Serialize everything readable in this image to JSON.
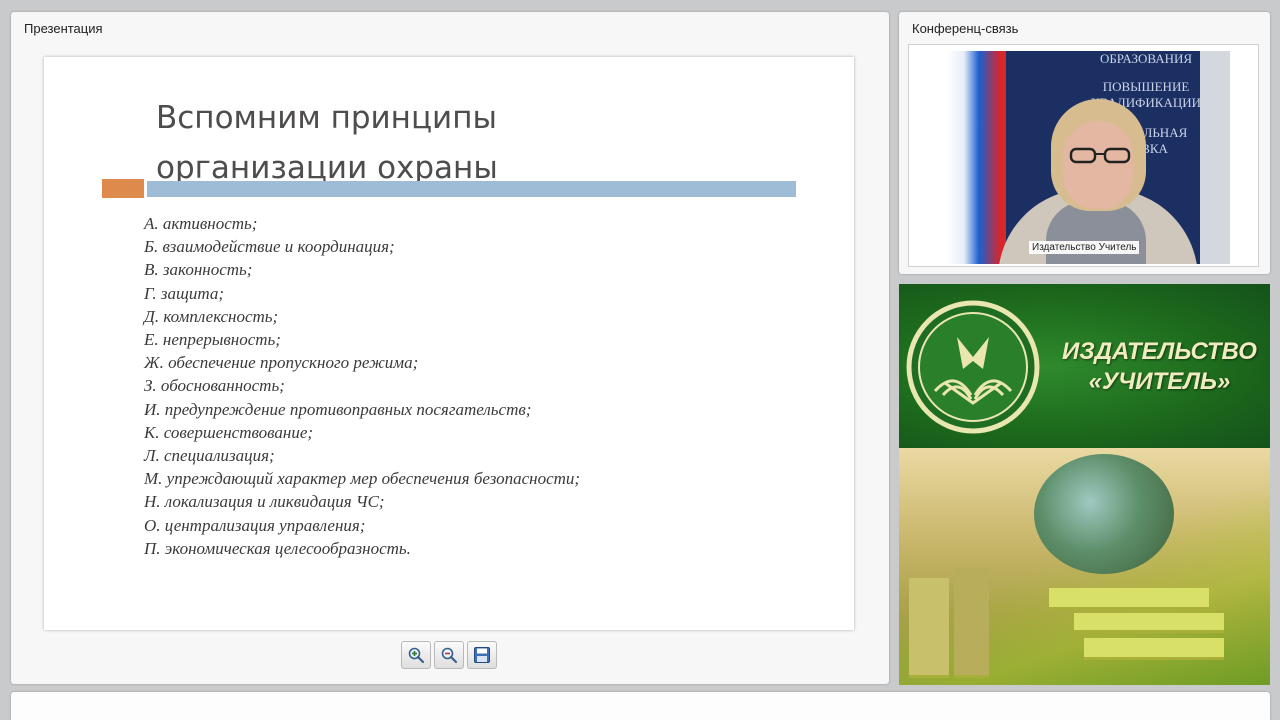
{
  "presentation_panel": {
    "title": "Презентация",
    "slide": {
      "title_line1": "Вспомним принципы",
      "title_line2": "организации охраны",
      "accent_colors": {
        "orange": "#dd8a4c",
        "blue": "#9fbcd6"
      },
      "principles": [
        "А. активность;",
        "Б. взаимодействие и координация;",
        "В. законность;",
        "Г. защита;",
        "Д. комплексность;",
        "Е. непрерывность;",
        "Ж. обеспечение пропускного режима;",
        "З. обоснованность;",
        "И. предупреждение противоправных посягательств;",
        "К. совершенствование;",
        "Л. специализация;",
        "М. упреждающий характер мер обеспечения безопасности;",
        "Н. локализация и ликвидация ЧС;",
        "О. централизация управления;",
        "П. экономическая целесообразность."
      ]
    },
    "toolbar": [
      {
        "icon": "zoom-in-icon"
      },
      {
        "icon": "zoom-out-icon"
      },
      {
        "icon": "save-icon"
      }
    ]
  },
  "conference_panel": {
    "title": "Конференц-связь",
    "video": {
      "participant_name": "Издательство Учитель",
      "background_text": [
        "ОБРАЗОВАНИЯ",
        "ПОВЫШЕНИЕ",
        "КВАЛИФИКАЦИИ",
        "ПРО         АЛЬНАЯ",
        "ТОВКА"
      ]
    }
  },
  "banner": {
    "line1": "ИЗДАТЕЛЬСТВО",
    "line2": "«УЧИТЕЛЬ»",
    "colors": {
      "green": "#1d6a1d",
      "text": "#f1ecc0"
    }
  }
}
